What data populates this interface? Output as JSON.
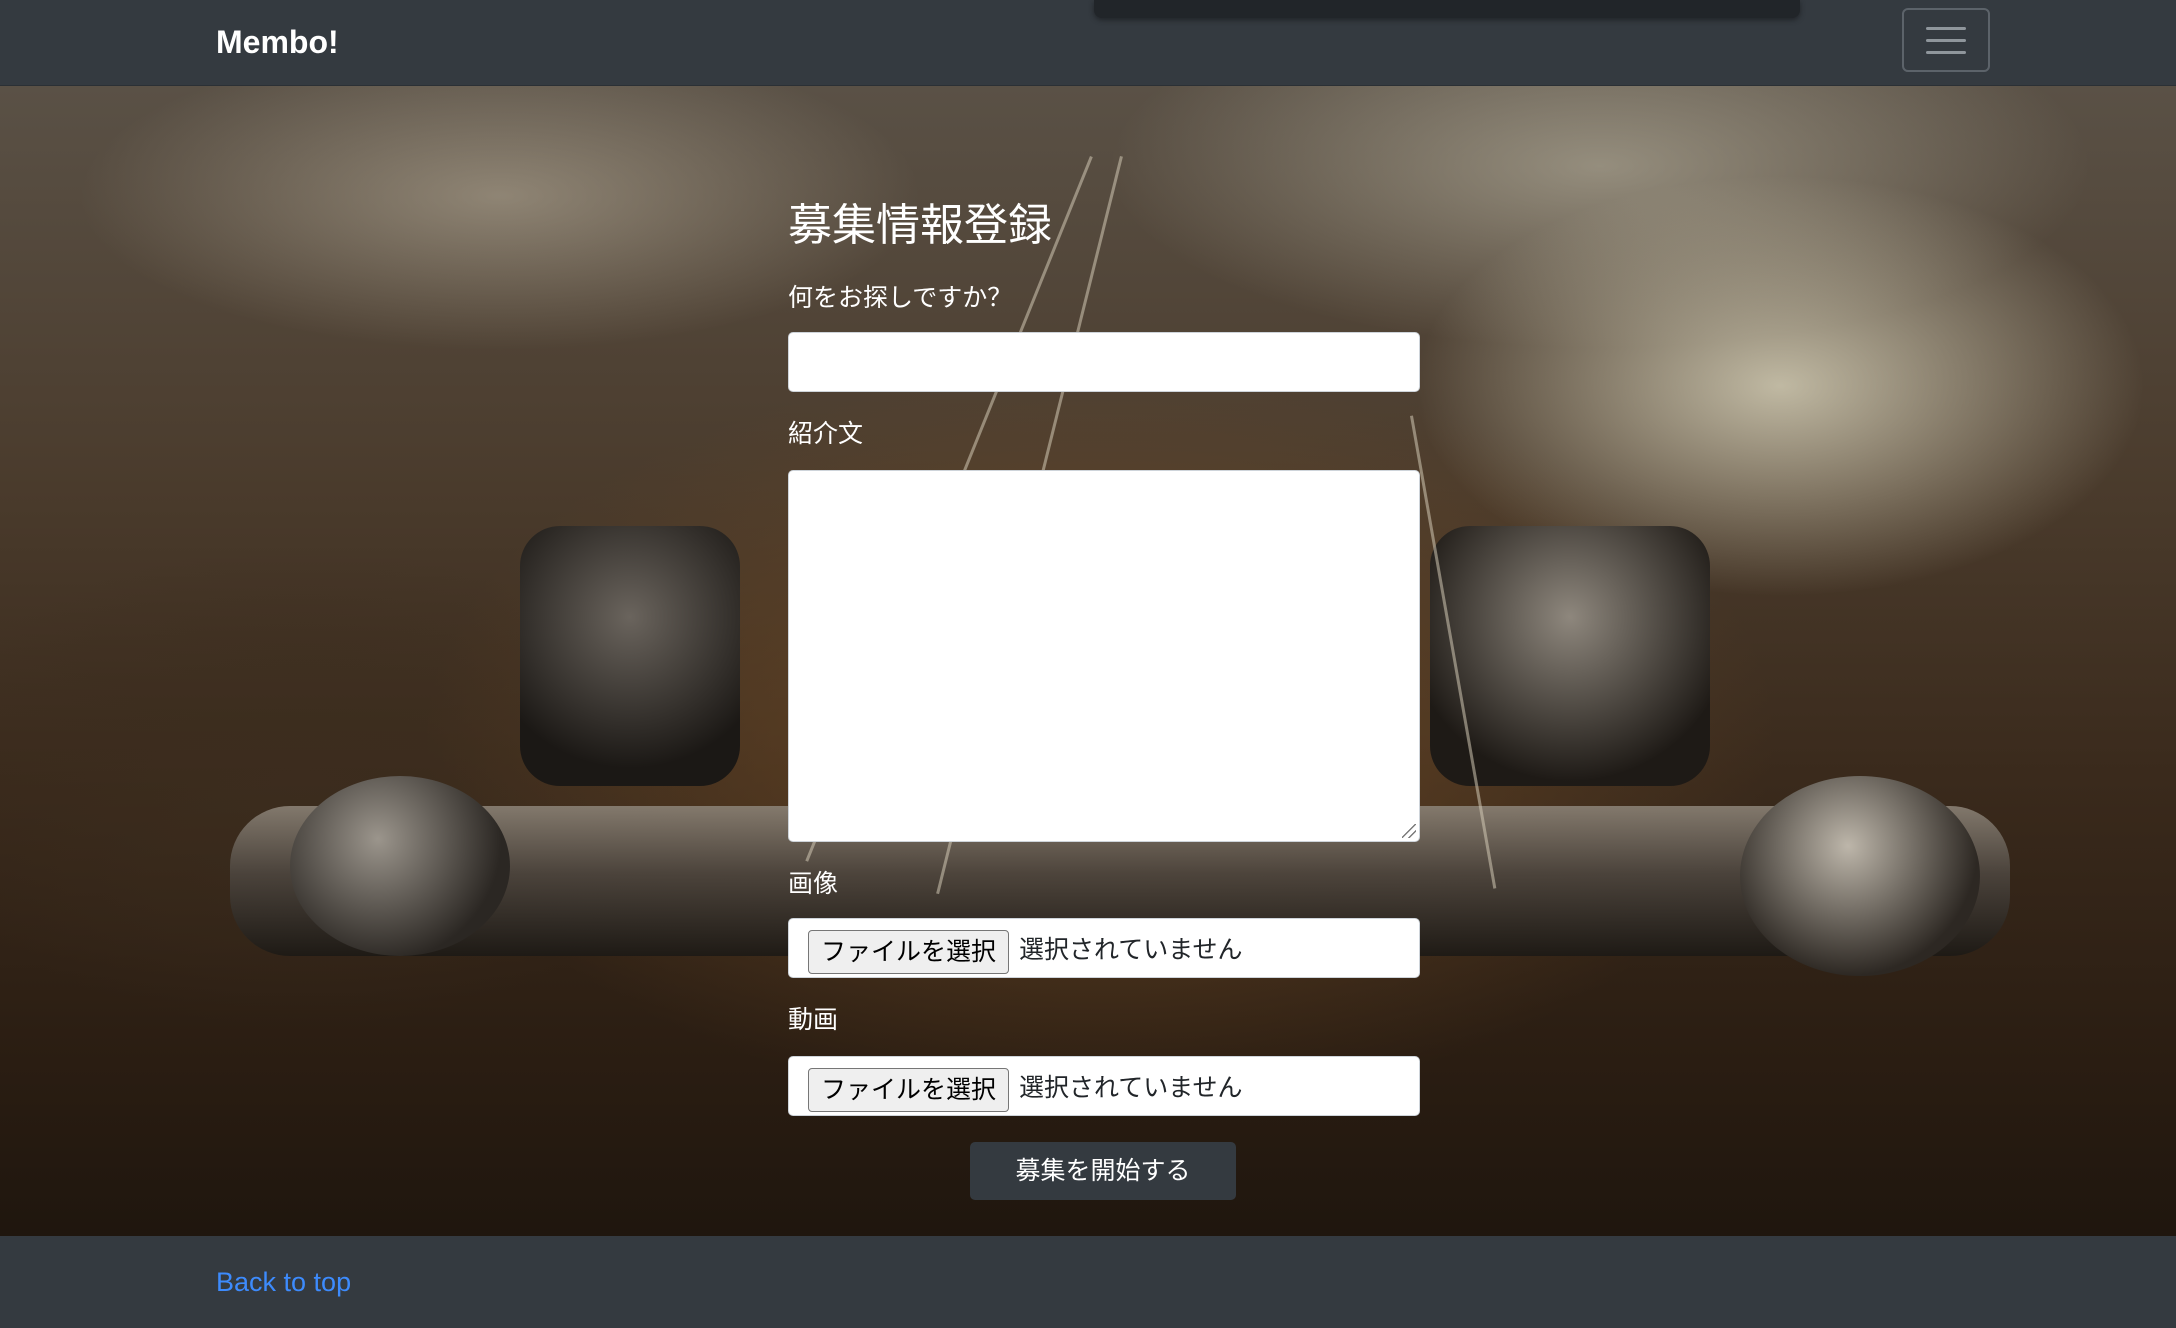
{
  "navbar": {
    "brand": "Membo!",
    "toggler_icon": "hamburger-menu-icon"
  },
  "form": {
    "title": "募集情報登録",
    "looking_for_label": "何をお探しですか？",
    "looking_for_value": "",
    "intro_label": "紹介文",
    "intro_value": "",
    "image_label": "画像",
    "video_label": "動画",
    "file_button_label": "ファイルを選択",
    "file_status": "選択されていません",
    "submit_label": "募集を開始する"
  },
  "footer": {
    "back_to_top": "Back to top"
  },
  "colors": {
    "navbar_bg": "#343a40",
    "link": "#3d8bfd",
    "submit_bg": "#343a40"
  }
}
